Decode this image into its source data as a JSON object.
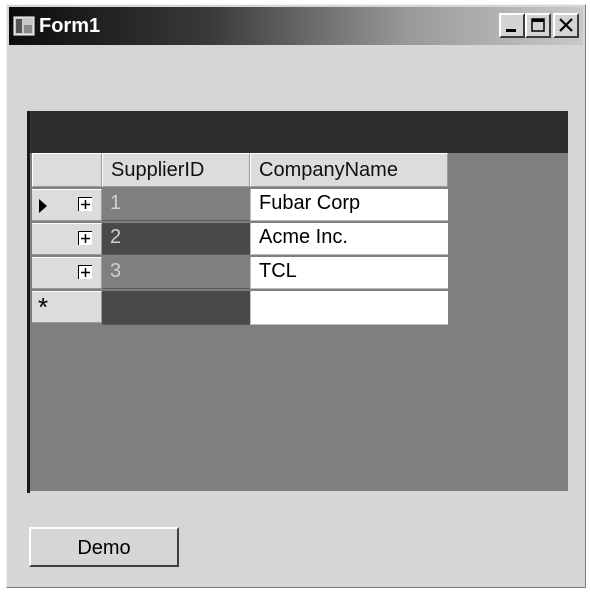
{
  "window": {
    "title": "Form1",
    "controls": {
      "minimize": "minimize",
      "maximize": "maximize",
      "close": "close"
    }
  },
  "grid": {
    "columns": [
      "SupplierID",
      "CompanyName"
    ],
    "rows": [
      {
        "supplier_id": "1",
        "company_name": "Fubar Corp",
        "expand": "+"
      },
      {
        "supplier_id": "2",
        "company_name": "Acme Inc.",
        "expand": "+"
      },
      {
        "supplier_id": "3",
        "company_name": "TCL",
        "expand": "+"
      }
    ],
    "new_row_marker": "*",
    "current_row_marker": "triangle-right-icon",
    "colors": {
      "caption": "#2e2e2e",
      "background": "#7f7f7f",
      "selected_id": "#494949"
    }
  },
  "buttons": {
    "demo": "Demo"
  },
  "icons": {
    "app": "form-window-icon",
    "expander": "plus-box-icon"
  }
}
